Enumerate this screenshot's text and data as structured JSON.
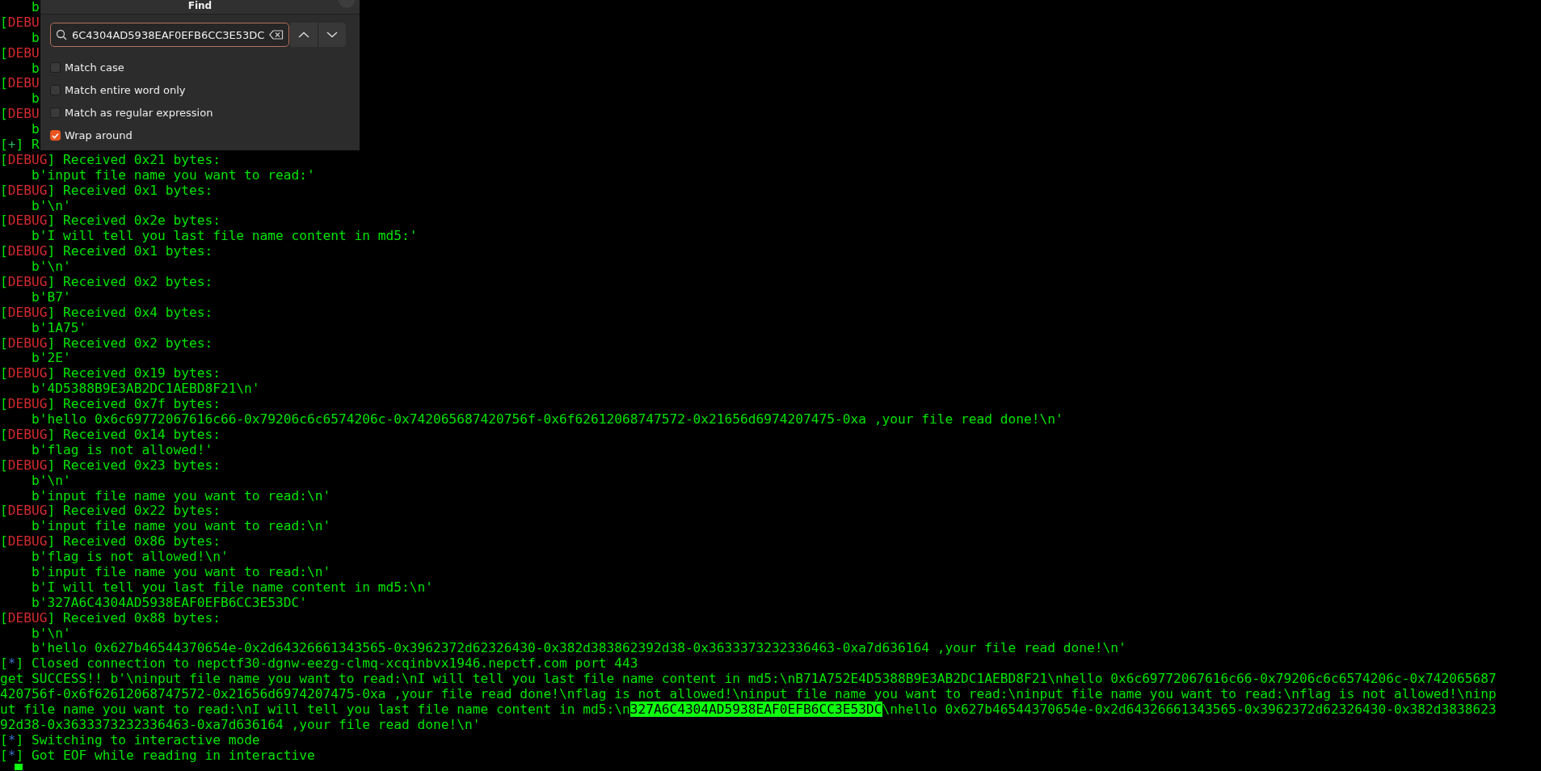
{
  "terminal": {
    "lines": [
      {
        "kind": "text",
        "parts": [
          "    b"
        ]
      },
      {
        "kind": "debug",
        "parts": [
          "[",
          "DEBU"
        ]
      },
      {
        "kind": "text",
        "parts": [
          "    b"
        ]
      },
      {
        "kind": "debug",
        "parts": [
          "[",
          "DEBU"
        ]
      },
      {
        "kind": "text",
        "parts": [
          "    b"
        ]
      },
      {
        "kind": "debug",
        "parts": [
          "[",
          "DEBU"
        ]
      },
      {
        "kind": "text",
        "parts": [
          "    b"
        ]
      },
      {
        "kind": "debug",
        "parts": [
          "[",
          "DEBU"
        ]
      },
      {
        "kind": "text",
        "parts": [
          "    b"
        ]
      },
      {
        "kind": "success",
        "parts": [
          "[",
          "+",
          "] R"
        ]
      },
      {
        "kind": "debug",
        "parts": [
          "[",
          "DEBUG",
          "] Received 0x21 bytes:"
        ]
      },
      {
        "kind": "text",
        "parts": [
          "    b'input file name you want to read:'"
        ]
      },
      {
        "kind": "debug",
        "parts": [
          "[",
          "DEBUG",
          "] Received 0x1 bytes:"
        ]
      },
      {
        "kind": "text",
        "parts": [
          "    b'\\n'"
        ]
      },
      {
        "kind": "debug",
        "parts": [
          "[",
          "DEBUG",
          "] Received 0x2e bytes:"
        ]
      },
      {
        "kind": "text",
        "parts": [
          "    b'I will tell you last file name content in md5:'"
        ]
      },
      {
        "kind": "debug",
        "parts": [
          "[",
          "DEBUG",
          "] Received 0x1 bytes:"
        ]
      },
      {
        "kind": "text",
        "parts": [
          "    b'\\n'"
        ]
      },
      {
        "kind": "debug",
        "parts": [
          "[",
          "DEBUG",
          "] Received 0x2 bytes:"
        ]
      },
      {
        "kind": "text",
        "parts": [
          "    b'B7'"
        ]
      },
      {
        "kind": "debug",
        "parts": [
          "[",
          "DEBUG",
          "] Received 0x4 bytes:"
        ]
      },
      {
        "kind": "text",
        "parts": [
          "    b'1A75'"
        ]
      },
      {
        "kind": "debug",
        "parts": [
          "[",
          "DEBUG",
          "] Received 0x2 bytes:"
        ]
      },
      {
        "kind": "text",
        "parts": [
          "    b'2E'"
        ]
      },
      {
        "kind": "debug",
        "parts": [
          "[",
          "DEBUG",
          "] Received 0x19 bytes:"
        ]
      },
      {
        "kind": "text",
        "parts": [
          "    b'4D5388B9E3AB2DC1AEBD8F21\\n'"
        ]
      },
      {
        "kind": "debug",
        "parts": [
          "[",
          "DEBUG",
          "] Received 0x7f bytes:"
        ]
      },
      {
        "kind": "text",
        "parts": [
          "    b'hello 0x6c69772067616c66-0x79206c6c6574206c-0x742065687420756f-0x6f62612068747572-0x21656d6974207475-0xa ,your file read done!\\n'"
        ]
      },
      {
        "kind": "debug",
        "parts": [
          "[",
          "DEBUG",
          "] Received 0x14 bytes:"
        ]
      },
      {
        "kind": "text",
        "parts": [
          "    b'flag is not allowed!'"
        ]
      },
      {
        "kind": "debug",
        "parts": [
          "[",
          "DEBUG",
          "] Received 0x23 bytes:"
        ]
      },
      {
        "kind": "text",
        "parts": [
          "    b'\\n'"
        ]
      },
      {
        "kind": "text",
        "parts": [
          "    b'input file name you want to read:\\n'"
        ]
      },
      {
        "kind": "debug",
        "parts": [
          "[",
          "DEBUG",
          "] Received 0x22 bytes:"
        ]
      },
      {
        "kind": "text",
        "parts": [
          "    b'input file name you want to read:\\n'"
        ]
      },
      {
        "kind": "debug",
        "parts": [
          "[",
          "DEBUG",
          "] Received 0x86 bytes:"
        ]
      },
      {
        "kind": "text",
        "parts": [
          "    b'flag is not allowed!\\n'"
        ]
      },
      {
        "kind": "text",
        "parts": [
          "    b'input file name you want to read:\\n'"
        ]
      },
      {
        "kind": "text",
        "parts": [
          "    b'I will tell you last file name content in md5:\\n'"
        ]
      },
      {
        "kind": "text",
        "parts": [
          "    b'327A6C4304AD5938EAF0EFB6CC3E53DC'"
        ]
      },
      {
        "kind": "debug",
        "parts": [
          "[",
          "DEBUG",
          "] Received 0x88 bytes:"
        ]
      },
      {
        "kind": "text",
        "parts": [
          "    b'\\n'"
        ]
      },
      {
        "kind": "text",
        "parts": [
          "    b'hello 0x627b46544370654e-0x2d64326661343565-0x3962372d62326430-0x382d383862392d38-0x3633373232336463-0xa7d636164 ,your file read done!\\n'"
        ]
      },
      {
        "kind": "info",
        "parts": [
          "[",
          "*",
          "] Closed connection to nepctf30-dgnw-eezg-clmq-xcqinbvx1946.nepctf.com port 443"
        ]
      },
      {
        "kind": "text",
        "parts": [
          "get SUCCESS!! b'\\ninput file name you want to read:\\nI will tell you last file name content in md5:\\nB71A752E4D5388B9E3AB2DC1AEBD8F21\\nhello 0x6c69772067616c66-0x79206c6c6574206c-0x742065687"
        ]
      },
      {
        "kind": "text",
        "parts": [
          "420756f-0x6f62612068747572-0x21656d6974207475-0xa ,your file read done!\\nflag is not allowed!\\ninput file name you want to read:\\ninput file name you want to read:\\nflag is not allowed!\\ninp"
        ]
      },
      {
        "kind": "match",
        "parts": [
          "ut file name you want to read:\\nI will tell you last file name content in md5:\\n",
          "327A6C4304AD5938EAF0EFB6CC3E53DC",
          "\\nhello 0x627b46544370654e-0x2d64326661343565-0x3962372d62326430-0x382d3838623"
        ]
      },
      {
        "kind": "text",
        "parts": [
          "92d38-0x3633373232336463-0xa7d636164 ,your file read done!\\n'"
        ]
      },
      {
        "kind": "info",
        "parts": [
          "[",
          "*",
          "] Switching to interactive mode"
        ]
      },
      {
        "kind": "info",
        "parts": [
          "[",
          "*",
          "] Got EOF while reading in interactive"
        ]
      }
    ]
  },
  "find_dialog": {
    "title": "Find",
    "search": {
      "value": "6C4304AD5938EAF0EFB6CC3E53DC"
    },
    "options": [
      {
        "label": "Match case",
        "checked": false
      },
      {
        "label": "Match entire word only",
        "checked": false
      },
      {
        "label": "Match as regular expression",
        "checked": false
      },
      {
        "label": "Wrap around",
        "checked": true
      }
    ]
  }
}
